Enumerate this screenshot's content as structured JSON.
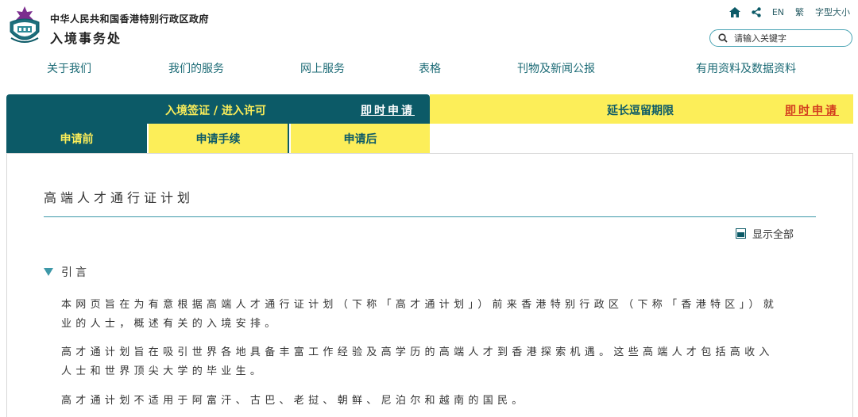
{
  "header": {
    "gov_name": "中华人民共和国香港特别行政区政府",
    "dept_name": "入境事务处",
    "tools": {
      "lang_en": "EN",
      "lang_trad": "繁",
      "font_size": "字型大小"
    },
    "search": {
      "placeholder": "请输入关键字"
    }
  },
  "nav": {
    "items": [
      "关于我们",
      "我们的服务",
      "网上服务",
      "表格",
      "刊物及新闻公报",
      "有用资料及数据资料"
    ]
  },
  "tabs": {
    "tab_a": {
      "title": "入境签证 / 进入许可",
      "link": "即时申请"
    },
    "tab_b": {
      "title": "延长逗留期限",
      "link": "即时申请"
    },
    "subtabs": [
      "申请前",
      "申请手续",
      "申请后"
    ]
  },
  "content": {
    "title": "高端人才通行证计划",
    "show_all": "显示全部",
    "section_title": "引言",
    "paragraphs": [
      "本网页旨在为有意根据高端人才通行证计划（下称「高才通计划」）前来香港特别行政区（下称「香港特区」）就业的人士，概述有关的入境安排。",
      "高才通计划旨在吸引世界各地具备丰富工作经验及高学历的高端人才到香港探索机遇。这些高端人才包括高收入人士和世界顶尖大学的毕业生。",
      "高才通计划不适用于阿富汗、古巴、老挝、朝鲜、尼泊尔和越南的国民。"
    ]
  },
  "colors": {
    "teal_dark": "#0c5a67",
    "yellow": "#fcee59",
    "link_red": "#d23b1e",
    "nav_teal": "#1c6b76"
  }
}
